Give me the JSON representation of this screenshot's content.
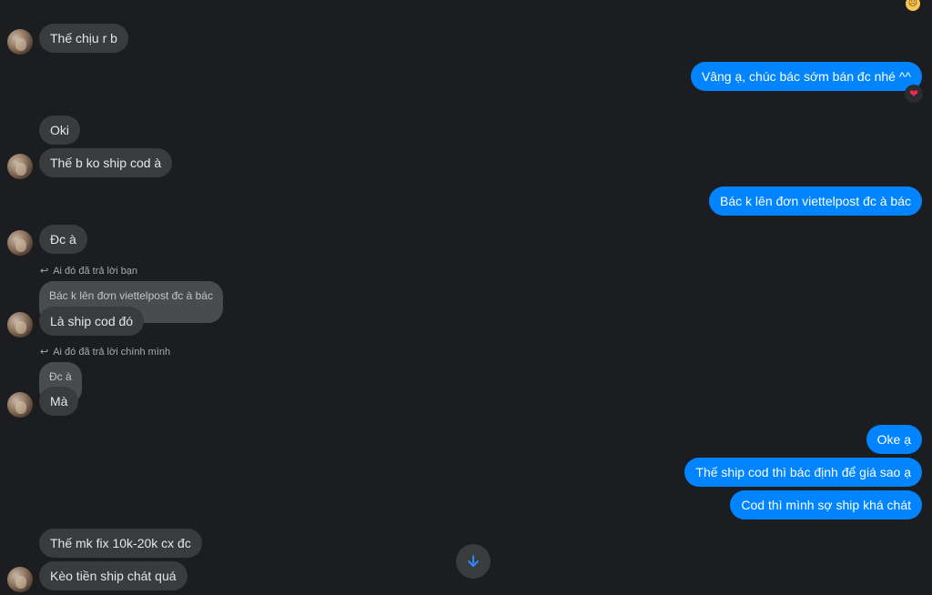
{
  "conversation": {
    "top_reaction_icon": "sad-face-emoji",
    "messages": [
      {
        "id": "m1",
        "text": "Thế chịu r b"
      },
      {
        "id": "m2",
        "text": "Vâng ạ, chúc bác sớm bán đc nhé ^^",
        "reaction": "❤"
      },
      {
        "id": "m3",
        "text": "Oki"
      },
      {
        "id": "m4",
        "text": "Thế b ko ship cod à"
      },
      {
        "id": "m5",
        "text": "Bác k lên đơn viettelpost đc à bác"
      },
      {
        "id": "m6",
        "text": "Đc à"
      },
      {
        "id": "m7",
        "reply_note": "Ai đó đã trả lời bạn",
        "quoted_text": "Bác k lên đơn viettelpost đc à bác",
        "text": "Là ship cod đó"
      },
      {
        "id": "m8",
        "reply_note": "Ai đó đã trả lời chính mình",
        "quoted_text": "Đc à",
        "text": "Mà"
      },
      {
        "id": "m9",
        "text": "Oke ạ"
      },
      {
        "id": "m10",
        "text": "Thế ship cod thì bác định để giá sao ạ"
      },
      {
        "id": "m11",
        "text": "Cod thì mình sợ ship khá chát"
      },
      {
        "id": "m12",
        "text": "Thế mk fix 10k-20k cx đc"
      },
      {
        "id": "m13",
        "text": "Kèo tiền ship chát quá"
      }
    ]
  },
  "colors": {
    "background": "#1c1d20",
    "incoming_bubble": "#3a3b3d",
    "outgoing_bubble": "#0084ff",
    "accent": "#0084ff"
  },
  "icons": {
    "scroll_down": "arrow-down-icon",
    "reply": "reply-arrow-icon",
    "heart": "heart-icon"
  }
}
